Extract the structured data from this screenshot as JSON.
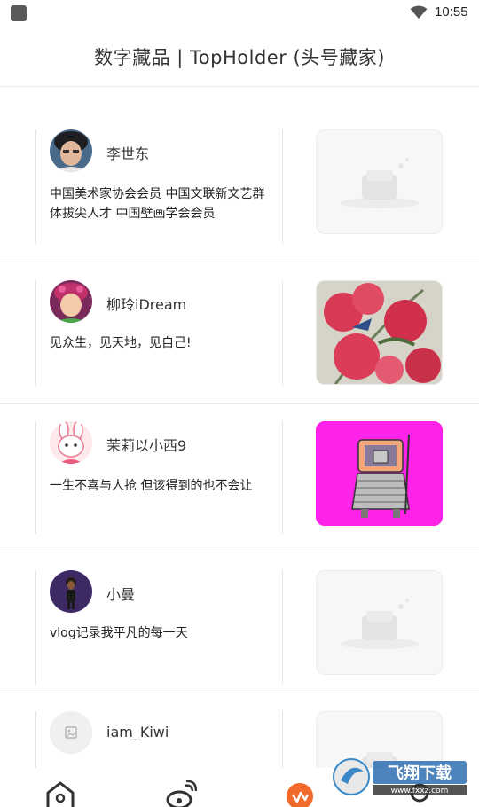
{
  "status_bar": {
    "time": "10:55"
  },
  "header": {
    "title": "数字藏品 | TopHolder (头号藏家)"
  },
  "holders": [
    {
      "name": "李世东",
      "bio": "中国美术家协会会员 中国文联新文艺群体拔尖人才 中国壁画学会会员",
      "thumb": "placeholder"
    },
    {
      "name": "柳玲iDream",
      "bio": "见众生，见天地，见自己!",
      "thumb": "red-flower-painting"
    },
    {
      "name": "茉莉以小西9",
      "bio": "一生不喜与人抢 但该得到的也不会让",
      "thumb": "pink-robot-art"
    },
    {
      "name": "小曼",
      "bio": "vlog记录我平凡的每一天",
      "thumb": "placeholder"
    },
    {
      "name": "iam_Kiwi",
      "bio": "",
      "thumb": "placeholder"
    }
  ],
  "tabbar": {
    "icons": [
      "home-icon",
      "weibo-icon",
      "brand-icon",
      "profile-icon"
    ],
    "accent": "#f06a2b"
  },
  "watermark": {
    "text": "飞翔下载",
    "url": "www.fxxz.com"
  }
}
